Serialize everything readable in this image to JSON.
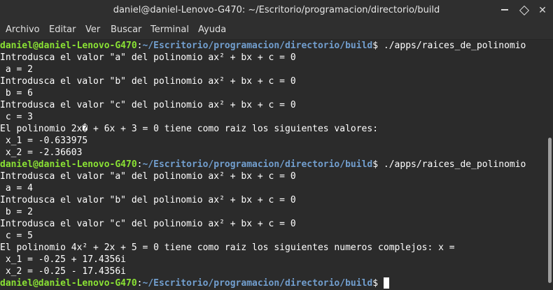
{
  "window": {
    "title": "daniel@daniel-Lenovo-G470: ~/Escritorio/programacion/directorio/build",
    "min_glyph": "",
    "max_glyph": "",
    "close_glyph": "✕"
  },
  "menu": [
    {
      "label": "Archivo"
    },
    {
      "label": "Editar"
    },
    {
      "label": "Ver"
    },
    {
      "label": "Buscar"
    },
    {
      "label": "Terminal"
    },
    {
      "label": "Ayuda"
    }
  ],
  "prompt": {
    "user": "daniel@daniel-Lenovo-G470",
    "sep": ":",
    "path": "~/Escritorio/programacion/directorio/build",
    "dollar": "$ "
  },
  "lines": [
    {
      "type": "prompt",
      "cmd": "./apps/raices_de_polinomio"
    },
    {
      "type": "text",
      "text": "Introdusca el valor \"a\" del polinomio ax² + bx + c = 0"
    },
    {
      "type": "text",
      "text": " a = 2"
    },
    {
      "type": "text",
      "text": "Introdusca el valor \"b\" del polinomio ax² + bx + c = 0"
    },
    {
      "type": "text",
      "text": " b = 6"
    },
    {
      "type": "text",
      "text": "Introdusca el valor \"c\" del polinomio ax² + bx + c = 0"
    },
    {
      "type": "text",
      "text": " c = 3"
    },
    {
      "type": "text",
      "text": "El polinomio 2x� + 6x + 3 = 0 tiene como raiz los siguientes valores:"
    },
    {
      "type": "text",
      "text": " x_1 = -0.633975"
    },
    {
      "type": "text",
      "text": " x_2 = -2.36603"
    },
    {
      "type": "prompt",
      "cmd": "./apps/raices_de_polinomio"
    },
    {
      "type": "text",
      "text": "Introdusca el valor \"a\" del polinomio ax² + bx + c = 0"
    },
    {
      "type": "text",
      "text": " a = 4"
    },
    {
      "type": "text",
      "text": "Introdusca el valor \"b\" del polinomio ax² + bx + c = 0"
    },
    {
      "type": "text",
      "text": " b = 2"
    },
    {
      "type": "text",
      "text": "Introdusca el valor \"c\" del polinomio ax² + bx + c = 0"
    },
    {
      "type": "text",
      "text": " c = 5"
    },
    {
      "type": "text",
      "text": "El polinomio 4x² + 2x + 5 = 0 tiene como raiz los siguientes numeros complejos: x ="
    },
    {
      "type": "text",
      "text": " x_1 = -0.25 + 17.4356i"
    },
    {
      "type": "text",
      "text": " x_2 = -0.25 - 17.4356i"
    },
    {
      "type": "prompt",
      "cmd": "",
      "cursor": true
    }
  ],
  "colors": {
    "user": "#8ae234",
    "path": "#729fcf",
    "background": "#2b2b2b"
  }
}
